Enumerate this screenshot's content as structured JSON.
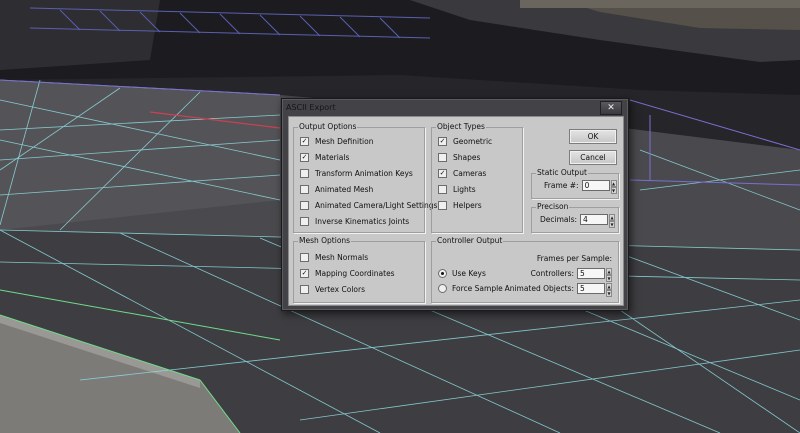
{
  "dialog": {
    "title": "ASCII Export",
    "close_glyph": "✕",
    "ok_label": "OK",
    "cancel_label": "Cancel"
  },
  "output_options": {
    "label": "Output Options",
    "items": [
      {
        "label": "Mesh Definition",
        "checked": true
      },
      {
        "label": "Materials",
        "checked": true
      },
      {
        "label": "Transform Animation Keys",
        "checked": false
      },
      {
        "label": "Animated Mesh",
        "checked": false
      },
      {
        "label": "Animated Camera/Light Settings",
        "checked": false
      },
      {
        "label": "Inverse Kinematics Joints",
        "checked": false
      }
    ]
  },
  "mesh_options": {
    "label": "Mesh Options",
    "items": [
      {
        "label": "Mesh Normals",
        "checked": false
      },
      {
        "label": "Mapping Coordinates",
        "checked": true
      },
      {
        "label": "Vertex Colors",
        "checked": false
      }
    ]
  },
  "object_types": {
    "label": "Object Types",
    "items": [
      {
        "label": "Geometric",
        "checked": true
      },
      {
        "label": "Shapes",
        "checked": false
      },
      {
        "label": "Cameras",
        "checked": true
      },
      {
        "label": "Lights",
        "checked": false
      },
      {
        "label": "Helpers",
        "checked": false
      }
    ]
  },
  "static_output": {
    "label": "Static Output",
    "frame_label": "Frame #:",
    "frame_value": "0"
  },
  "precision": {
    "label": "Precison",
    "decimals_label": "Decimals:",
    "decimals_value": "4"
  },
  "controller_output": {
    "label": "Controller Output",
    "frames_per_sample_label": "Frames per Sample:",
    "use_keys_label": "Use Keys",
    "use_keys_selected": true,
    "force_sample_label": "Force Sample",
    "force_sample_selected": false,
    "controllers_label": "Controllers:",
    "controllers_value": "5",
    "animated_objects_label": "Animated Objects:",
    "animated_objects_value": "5"
  },
  "glyphs": {
    "check": "✓",
    "spin_up": "▲",
    "spin_down": "▼"
  },
  "colors": {
    "dialog_frame": "#434347",
    "client_bg": "#c8c8c8",
    "wire_cyan": "#8fe0e6",
    "wire_purple": "#7a6fd0",
    "wire_green": "#6fdc8a"
  }
}
